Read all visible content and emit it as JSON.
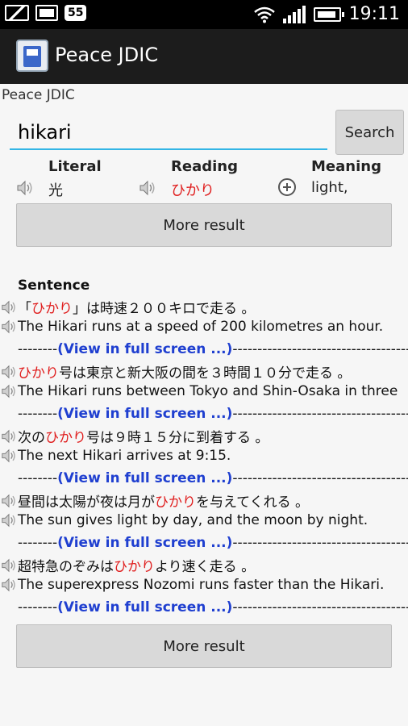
{
  "status": {
    "time": "19:11",
    "badge": "55"
  },
  "app": {
    "title": "Peace JDIC",
    "subtitle": "Peace JDIC"
  },
  "search": {
    "value": "hikari",
    "button": "Search"
  },
  "columns": {
    "literal": {
      "header": "Literal",
      "value": "光"
    },
    "reading": {
      "header": "Reading",
      "value": "ひかり"
    },
    "meaning": {
      "header": "Meaning",
      "value": "light,"
    }
  },
  "more_result": "More result",
  "sentence_header": "Sentence",
  "sentences": [
    {
      "jp_pre": "「",
      "jp_hl": "ひかり",
      "jp_post": "」は時速２００キロで走る 。",
      "en": "The Hikari runs at a speed of 200 kilometres an hour."
    },
    {
      "jp_pre": "",
      "jp_hl": "ひかり",
      "jp_post": "号は東京と新大阪の間を３時間１０分で走る 。",
      "en": "The Hikari runs between Tokyo and Shin-Osaka in three"
    },
    {
      "jp_pre": "次の",
      "jp_hl": "ひかり",
      "jp_post": "号は９時１５分に到着する 。",
      "en": "The next Hikari arrives at 9:15."
    },
    {
      "jp_pre": "昼間は太陽が夜は月が",
      "jp_hl": "ひかり",
      "jp_post": "を与えてくれる 。",
      "en": "The sun gives light by day, and the moon by night."
    },
    {
      "jp_pre": "超特急のぞみは",
      "jp_hl": "ひかり",
      "jp_post": "より速く走る 。",
      "en": "The superexpress Nozomi runs faster than the Hikari."
    }
  ],
  "separator": {
    "left": "--------",
    "link": "(View in full screen ...)",
    "right": "-----------------------------------------------"
  },
  "icons": {
    "speaker": "speaker-icon",
    "plus": "plus-circle-icon",
    "accent": "#33b5e5",
    "highlight": "#e02020",
    "link": "#1f3fd0"
  }
}
